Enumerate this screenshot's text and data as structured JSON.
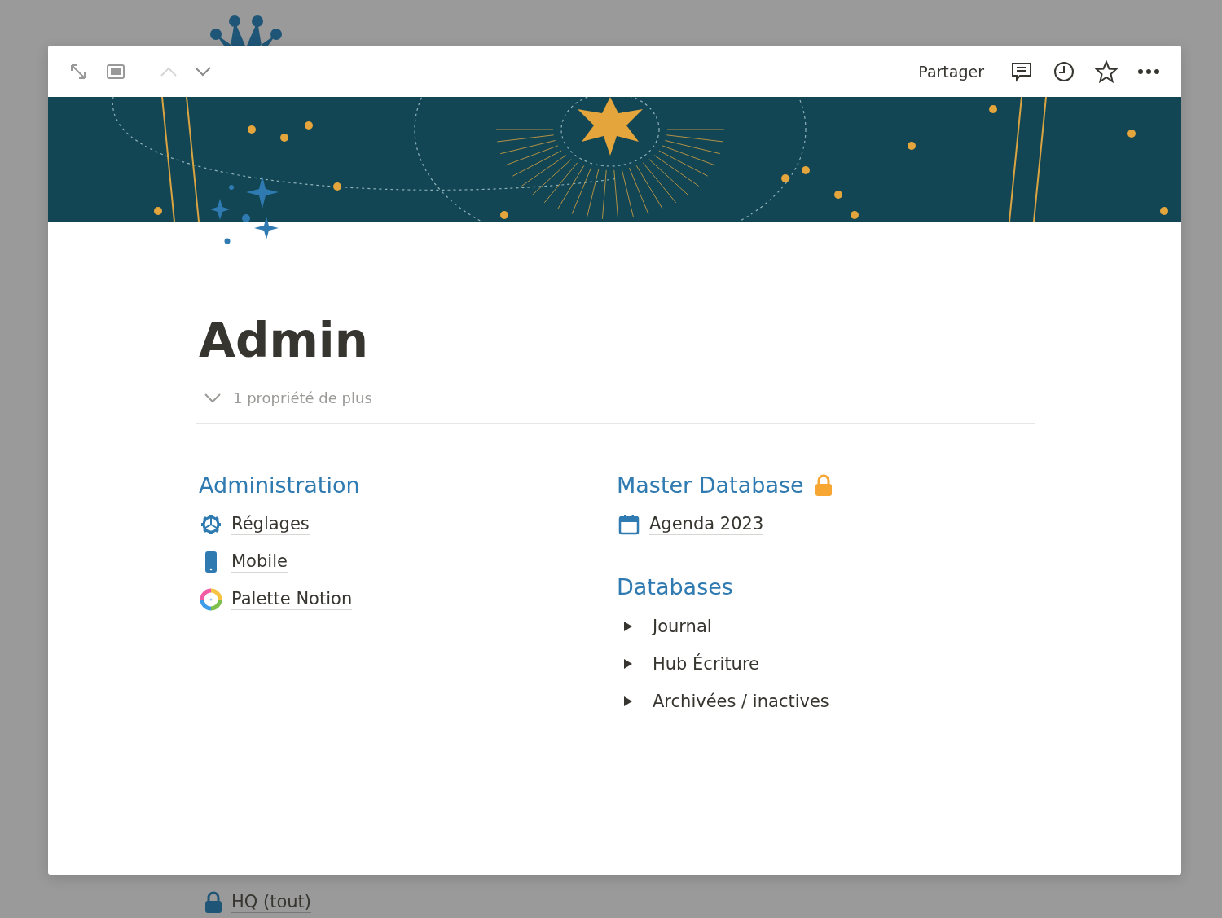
{
  "toolbar": {
    "share_label": "Partager"
  },
  "page": {
    "title": "Admin",
    "properties_toggle": {
      "label": "1 propriété de plus",
      "expanded": false
    }
  },
  "columns": [
    {
      "sections": [
        {
          "heading": "Administration",
          "locked": false,
          "items": [
            {
              "kind": "gear",
              "label": "Réglages"
            },
            {
              "kind": "phone",
              "label": "Mobile"
            },
            {
              "kind": "palette",
              "label": "Palette Notion"
            }
          ]
        }
      ]
    },
    {
      "sections": [
        {
          "heading": "Master Database",
          "locked": true,
          "items": [
            {
              "kind": "calendar",
              "label": "Agenda 2023"
            }
          ]
        },
        {
          "heading": "Databases",
          "locked": false,
          "items": [
            {
              "kind": "toggle",
              "label": "Journal",
              "expanded": false
            },
            {
              "kind": "toggle",
              "label": "Hub Écriture",
              "expanded": false
            },
            {
              "kind": "toggle",
              "label": "Archivées / inactives",
              "expanded": false
            }
          ]
        }
      ]
    }
  ],
  "background_page": {
    "link": "HQ (tout)"
  }
}
